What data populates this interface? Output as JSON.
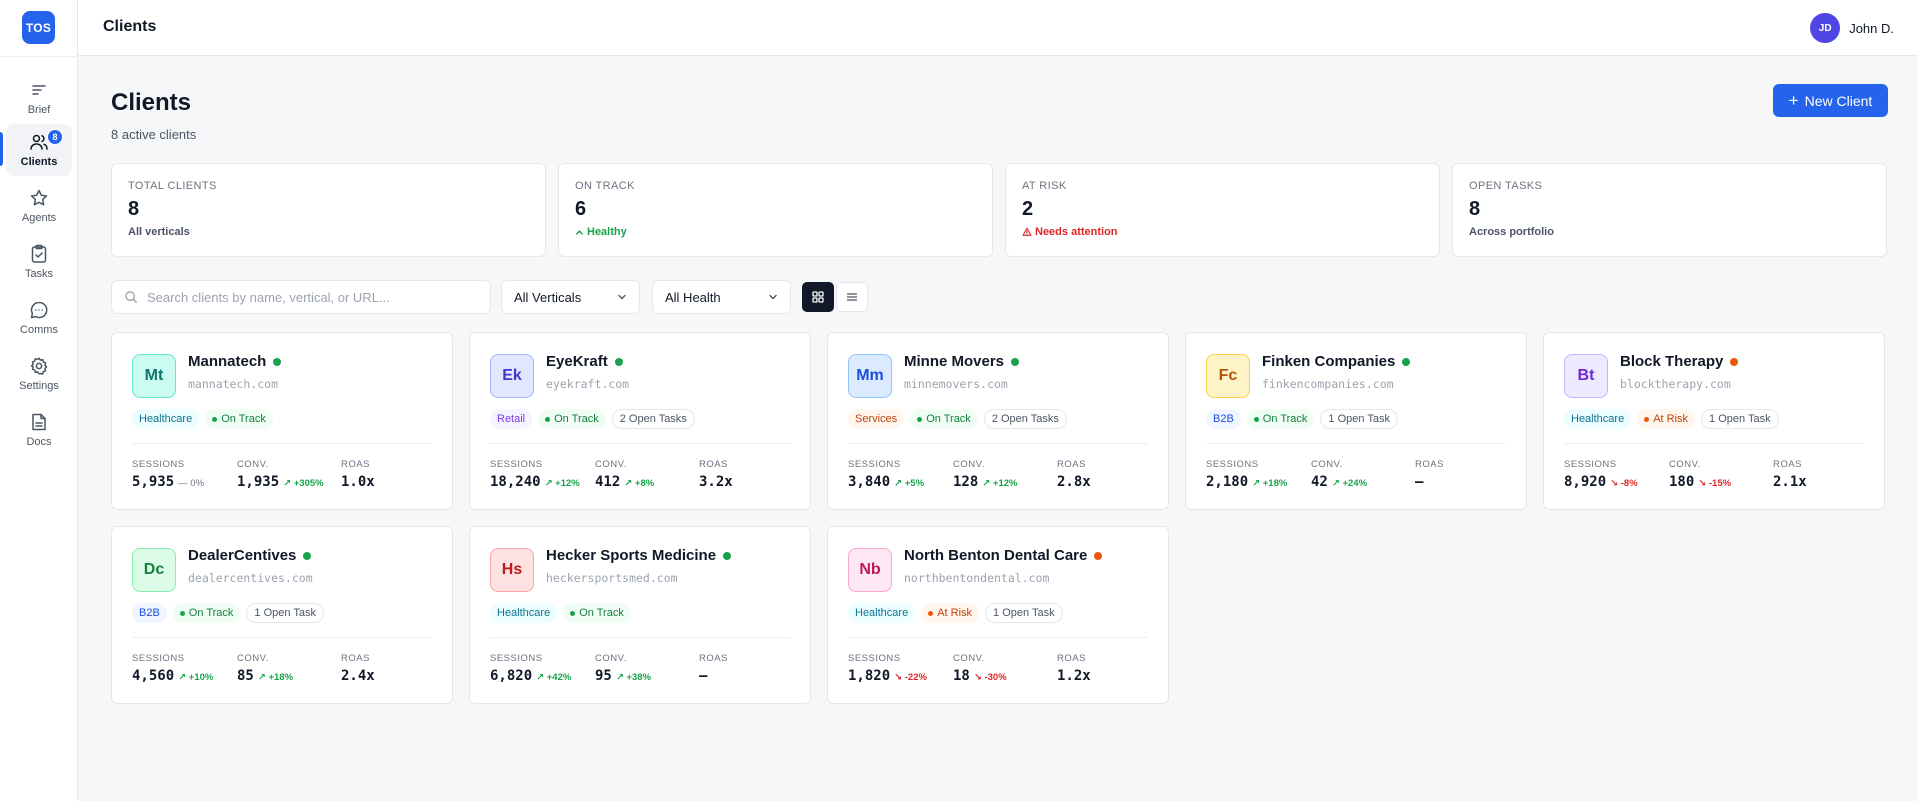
{
  "app": {
    "logo": "TOS"
  },
  "sidebar": {
    "items": [
      {
        "id": "brief",
        "label": "Brief",
        "icon": "brief-icon"
      },
      {
        "id": "clients",
        "label": "Clients",
        "icon": "users-icon",
        "badge": "8",
        "active": true
      },
      {
        "id": "agents",
        "label": "Agents",
        "icon": "star-icon"
      },
      {
        "id": "tasks",
        "label": "Tasks",
        "icon": "clipboard-check-icon"
      },
      {
        "id": "comms",
        "label": "Comms",
        "icon": "chat-bubble-icon"
      },
      {
        "id": "settings",
        "label": "Settings",
        "icon": "gear-icon"
      },
      {
        "id": "docs",
        "label": "Docs",
        "icon": "document-icon"
      }
    ]
  },
  "header": {
    "title": "Clients",
    "user": {
      "initials": "JD",
      "name": "John D."
    }
  },
  "page": {
    "title": "Clients",
    "subtitle": "8 active clients",
    "new_button": "New Client"
  },
  "stats": [
    {
      "label": "Total Clients",
      "value": "8",
      "note": "All verticals",
      "tone": "neutral"
    },
    {
      "label": "On Track",
      "value": "6",
      "note": "Healthy",
      "tone": "good"
    },
    {
      "label": "At Risk",
      "value": "2",
      "note": "Needs attention",
      "tone": "bad"
    },
    {
      "label": "Open Tasks",
      "value": "8",
      "note": "Across portfolio",
      "tone": "neutral"
    }
  ],
  "filters": {
    "search_placeholder": "Search clients by name, vertical, or URL...",
    "vertical": "All Verticals",
    "health": "All Health"
  },
  "colors": {
    "accent": "#2563eb",
    "on_track": "#16a34a",
    "at_risk": "#ea580c"
  },
  "clients": [
    {
      "initials": "Mt",
      "name": "Mannatech",
      "url": "mannatech.com",
      "vertical": "Healthcare",
      "health": "On Track",
      "tasks": "",
      "sessions": "5,935",
      "sessions_delta": "— 0%",
      "sessions_trend": "flat",
      "conv": "1,935",
      "conv_delta": "↗ +305%",
      "conv_trend": "up",
      "roas": "1.0x",
      "palette": "teal"
    },
    {
      "initials": "Ek",
      "name": "EyeKraft",
      "url": "eyekraft.com",
      "vertical": "Retail",
      "health": "On Track",
      "tasks": "2 Open Tasks",
      "sessions": "18,240",
      "sessions_delta": "↗ +12%",
      "sessions_trend": "up",
      "conv": "412",
      "conv_delta": "↗ +8%",
      "conv_trend": "up",
      "roas": "3.2x",
      "palette": "indigo"
    },
    {
      "initials": "Mm",
      "name": "Minne Movers",
      "url": "minnemovers.com",
      "vertical": "Services",
      "health": "On Track",
      "tasks": "2 Open Tasks",
      "sessions": "3,840",
      "sessions_delta": "↗ +5%",
      "sessions_trend": "up",
      "conv": "128",
      "conv_delta": "↗ +12%",
      "conv_trend": "up",
      "roas": "2.8x",
      "palette": "blue"
    },
    {
      "initials": "Fc",
      "name": "Finken Companies",
      "url": "finkencompanies.com",
      "vertical": "B2B",
      "health": "On Track",
      "tasks": "1 Open Task",
      "sessions": "2,180",
      "sessions_delta": "↗ +18%",
      "sessions_trend": "up",
      "conv": "42",
      "conv_delta": "↗ +24%",
      "conv_trend": "up",
      "roas": "—",
      "palette": "amber"
    },
    {
      "initials": "Bt",
      "name": "Block Therapy",
      "url": "blocktherapy.com",
      "vertical": "Healthcare",
      "health": "At Risk",
      "tasks": "1 Open Task",
      "sessions": "8,920",
      "sessions_delta": "↘ -8%",
      "sessions_trend": "down",
      "conv": "180",
      "conv_delta": "↘ -15%",
      "conv_trend": "down",
      "roas": "2.1x",
      "palette": "purple"
    },
    {
      "initials": "Dc",
      "name": "DealerCentives",
      "url": "dealercentives.com",
      "vertical": "B2B",
      "health": "On Track",
      "tasks": "1 Open Task",
      "sessions": "4,560",
      "sessions_delta": "↗ +10%",
      "sessions_trend": "up",
      "conv": "85",
      "conv_delta": "↗ +18%",
      "conv_trend": "up",
      "roas": "2.4x",
      "palette": "green"
    },
    {
      "initials": "Hs",
      "name": "Hecker Sports Medicine",
      "url": "heckersportsmed.com",
      "vertical": "Healthcare",
      "health": "On Track",
      "tasks": "",
      "sessions": "6,820",
      "sessions_delta": "↗ +42%",
      "sessions_trend": "up",
      "conv": "95",
      "conv_delta": "↗ +38%",
      "conv_trend": "up",
      "roas": "—",
      "palette": "red"
    },
    {
      "initials": "Nb",
      "name": "North Benton Dental Care",
      "url": "northbentondental.com",
      "vertical": "Healthcare",
      "health": "At Risk",
      "tasks": "1 Open Task",
      "sessions": "1,820",
      "sessions_delta": "↘ -22%",
      "sessions_trend": "down",
      "conv": "18",
      "conv_delta": "↘ -30%",
      "conv_trend": "down",
      "roas": "1.2x",
      "palette": "pink"
    }
  ],
  "metric_labels": {
    "sessions": "Sessions",
    "conv": "Conv.",
    "roas": "ROAS"
  }
}
